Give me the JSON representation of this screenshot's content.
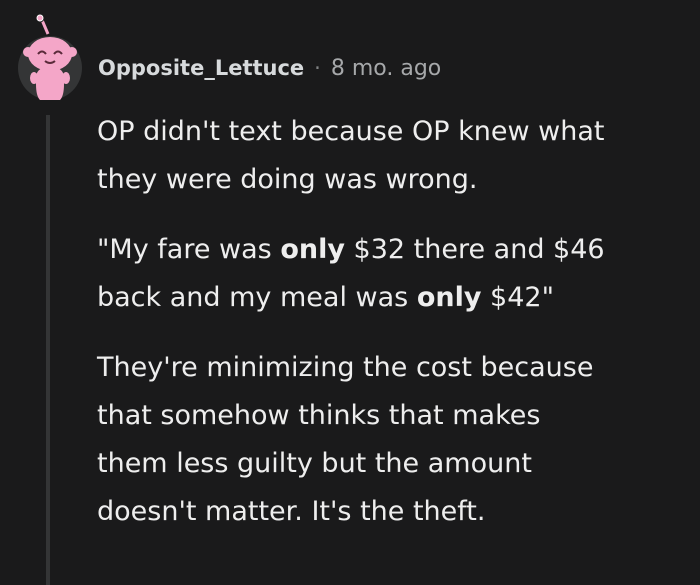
{
  "comment": {
    "author": "Opposite_Lettuce",
    "separator": "·",
    "timestamp": "8 mo. ago",
    "avatar_icon": "snoo-avatar-icon",
    "colors": {
      "background": "#1a1a1b",
      "text": "#eeeeee",
      "meta": "#a6a8aa",
      "thread_line": "#343536",
      "avatar_pink": "#f4a6c8"
    },
    "paragraphs": {
      "p1": {
        "line1": "OP didn't text because OP knew what",
        "line2": "they were doing was wrong."
      },
      "p2": {
        "part1": "\"My fare was ",
        "bold1": "only",
        "part2": " $32 there and $46",
        "part3": "back and my meal was ",
        "bold2": "only",
        "part4": " $42\""
      },
      "p3": {
        "line1": "They're minimizing the cost because",
        "line2": "that somehow thinks that makes",
        "line3": "them less guilty but the amount",
        "line4": "doesn't matter. It's the theft."
      }
    }
  }
}
